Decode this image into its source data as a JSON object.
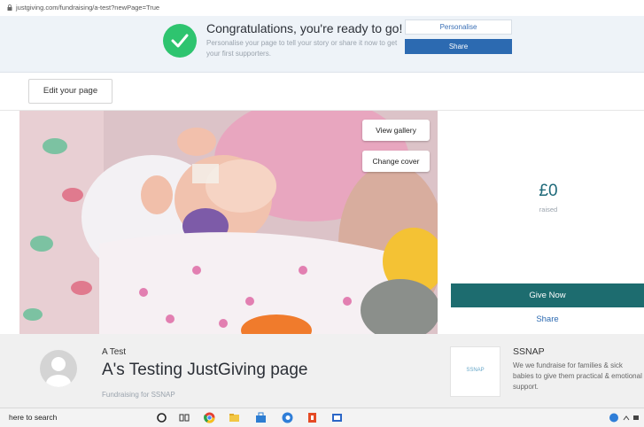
{
  "browser": {
    "url": "justgiving.com/fundraising/a-test?newPage=True"
  },
  "banner": {
    "title": "Congratulations, you're ready to go!",
    "subtitle": "Personalise your page to tell your story or share it now to get your first supporters.",
    "personalise_label": "Personalise",
    "share_label": "Share"
  },
  "edit": {
    "label": "Edit your page"
  },
  "cover": {
    "gallery_label": "View gallery",
    "change_cover_label": "Change cover"
  },
  "raised": {
    "amount": "£0",
    "label": "raised",
    "give_label": "Give Now",
    "share_label": "Share"
  },
  "page": {
    "owner": "A Test",
    "title": "A's Testing JustGiving page",
    "fundraising_for": "Fundraising for SSNAP"
  },
  "charity": {
    "logo_text": "SSNAP",
    "name": "SSNAP",
    "description": "We we fundraise for families & sick babies to give them practical & emotional support."
  },
  "taskbar": {
    "search_text": "here to search"
  },
  "colors": {
    "accent_green": "#2ec46f",
    "share_blue": "#2c6ab1",
    "give_teal": "#1d6c6f"
  }
}
